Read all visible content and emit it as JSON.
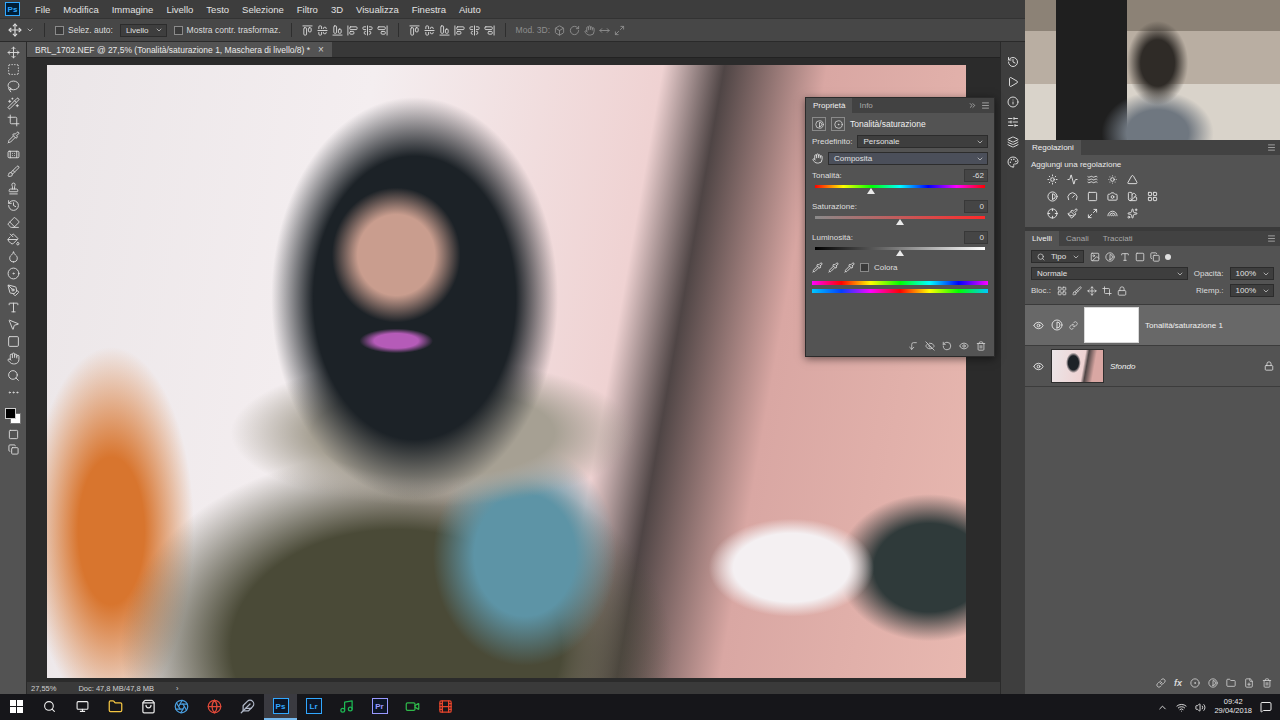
{
  "app": {
    "logo": "Ps"
  },
  "menu": [
    "File",
    "Modifica",
    "Immagine",
    "Livello",
    "Testo",
    "Selezione",
    "Filtro",
    "3D",
    "Visualizza",
    "Finestra",
    "Aiuto"
  ],
  "options_bar": {
    "auto_select": {
      "label": "Selez. auto:",
      "checked": false
    },
    "auto_select_target": "Livello",
    "show_transform": {
      "label": "Mostra contr. trasformaz.",
      "checked": false
    },
    "mode_3d": "Mod. 3D:"
  },
  "document_tab": {
    "title": "BRL_1702.NEF @ 27,5% (Tonalità/saturazione 1, Maschera di livello/8) *",
    "close": "×"
  },
  "properties": {
    "tabs": [
      {
        "label": "Proprietà",
        "selected": true
      },
      {
        "label": "Info",
        "selected": false
      }
    ],
    "title": "Tonalità/saturazione",
    "preset_label": "Predefinito:",
    "preset": "Personale",
    "channel": "Composita",
    "sliders": [
      {
        "label": "Tonalità:",
        "value": "-62",
        "level": 0.328,
        "kind": "hue"
      },
      {
        "label": "Saturazione:",
        "value": "0",
        "level": 0.5,
        "kind": "saturation"
      },
      {
        "label": "Luminosità:",
        "value": "0",
        "level": 0.5,
        "kind": "lightness"
      }
    ],
    "colorize": {
      "label": "Colora",
      "checked": false
    }
  },
  "adjustments": {
    "title": "Regolazioni",
    "subtitle": "Aggiungi una regolazione"
  },
  "layers_panel": {
    "tabs": [
      {
        "label": "Livelli",
        "selected": true
      },
      {
        "label": "Canali",
        "selected": false
      },
      {
        "label": "Tracciati",
        "selected": false
      }
    ],
    "filter": "Tipo",
    "blend_mode": "Normale",
    "opacity_label": "Opacità:",
    "opacity": "100%",
    "lock_label": "Bloc.:",
    "fill_label": "Riemp.:",
    "fill": "100%",
    "layers": [
      {
        "name": "Tonalità/saturazione 1",
        "visible": true,
        "selected": true,
        "locked": false,
        "kind": "adjustment"
      },
      {
        "name": "Sfondo",
        "visible": true,
        "selected": false,
        "locked": true,
        "kind": "image"
      }
    ],
    "footer_fx": "fx"
  },
  "status_bar": {
    "zoom": "27,55%",
    "doc": "Doc: 47,8 MB/47,8 MB",
    "arrow": "›"
  },
  "taskbar": {
    "apps": [
      {
        "kind": "icon",
        "color": "#f4c542",
        "active": false
      },
      {
        "kind": "icon",
        "color": "#e6e6e6",
        "active": false
      },
      {
        "kind": "icon",
        "color": "#4a9fe0",
        "active": false
      },
      {
        "kind": "icon",
        "color": "#e04a3a",
        "active": false
      },
      {
        "kind": "icon",
        "color": "#b0b8c8",
        "active": false
      },
      {
        "kind": "logo",
        "label": "Ps",
        "color": "#31a8ff",
        "active": true
      },
      {
        "kind": "logo",
        "label": "Lr",
        "color": "#31a8ff",
        "active": false
      },
      {
        "kind": "icon",
        "color": "#1db954",
        "active": false
      },
      {
        "kind": "logo",
        "label": "Pr",
        "color": "#9999ff",
        "active": false
      },
      {
        "kind": "icon",
        "color": "#2fb84a",
        "active": false
      },
      {
        "kind": "icon",
        "color": "#e8452c",
        "active": false
      }
    ],
    "time": "09:42",
    "date": "29/04/2018"
  }
}
